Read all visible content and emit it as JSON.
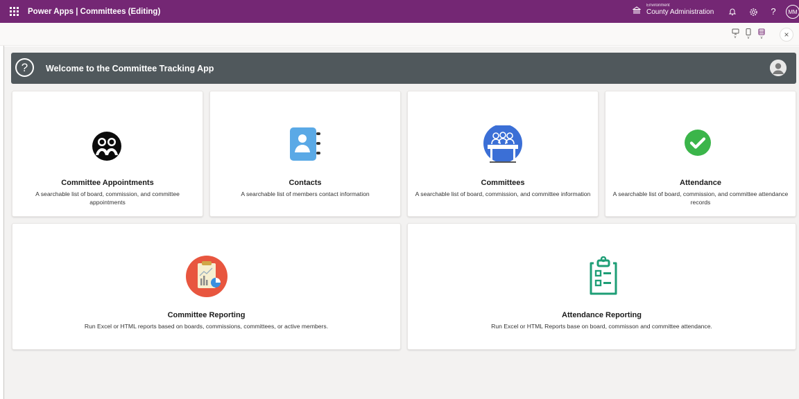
{
  "topbar": {
    "app_title": "Power Apps | Committees (Editing)",
    "environment_label": "Environment",
    "environment_name": "County Administration",
    "help_label": "?",
    "user_initials": "MM"
  },
  "cmdbar": {
    "close_label": "×"
  },
  "header": {
    "help_glyph": "?",
    "title": "Welcome to the Committee Tracking App"
  },
  "cards": [
    {
      "title": "Committee Appointments",
      "description": "A searchable list of  board, commission, and committee appointments",
      "icon": "people-group-icon"
    },
    {
      "title": "Contacts",
      "description": "A searchable list of members contact information",
      "icon": "contact-book-icon"
    },
    {
      "title": "Committees",
      "description": "A searchable list of  board, commission, and committee information",
      "icon": "committee-meeting-icon"
    },
    {
      "title": "Attendance",
      "description": "A searchable list of  board, commission, and committee attendance records",
      "icon": "checkmark-circle-icon"
    },
    {
      "title": "Committee Reporting",
      "description": "Run Excel or HTML reports based on boards, commissions, committees, or active members.",
      "icon": "report-clipboard-chart-icon"
    },
    {
      "title": "Attendance Reporting",
      "description": "Run Excel or HTML Reports base on board, commisson and committee attendance.",
      "icon": "checklist-clipboard-icon"
    }
  ],
  "colors": {
    "suite_bar": "#742774",
    "header_bar": "#50585c",
    "canvas": "#f3f2f1",
    "contacts_blue": "#5aa9e6",
    "committees_blue": "#3b6fd6",
    "attendance_green": "#3bb54a",
    "reporting_red": "#e8563f",
    "att_report_teal": "#1e9e76"
  }
}
